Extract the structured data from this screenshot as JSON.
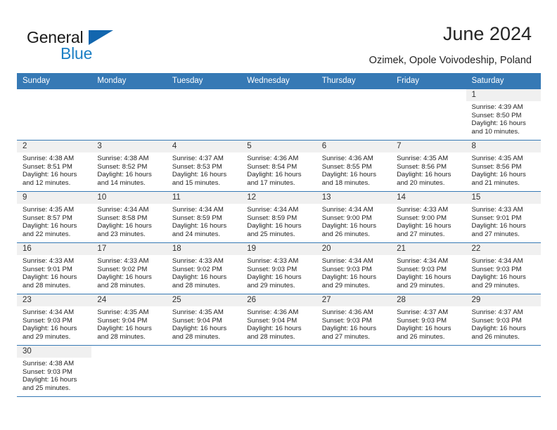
{
  "brand": {
    "name_top": "General",
    "name_bottom": "Blue",
    "sail_icon": "sail-triangle-icon",
    "colors": {
      "black": "#1a1a1a",
      "blue": "#1c7fc4",
      "sail": "#1266ae"
    }
  },
  "header": {
    "title": "June 2024",
    "subtitle": "Ozimek, Opole Voivodeship, Poland"
  },
  "calendar": {
    "header_background": "#3679b5",
    "header_text_color": "#ffffff",
    "daynum_background": "#f0f0f0",
    "weekdays": [
      "Sunday",
      "Monday",
      "Tuesday",
      "Wednesday",
      "Thursday",
      "Friday",
      "Saturday"
    ],
    "labels": {
      "sunrise": "Sunrise:",
      "sunset": "Sunset:",
      "daylight": "Daylight:"
    },
    "weeks": [
      [
        {
          "day": "",
          "blank": true
        },
        {
          "day": "",
          "blank": true
        },
        {
          "day": "",
          "blank": true
        },
        {
          "day": "",
          "blank": true
        },
        {
          "day": "",
          "blank": true
        },
        {
          "day": "",
          "blank": true
        },
        {
          "day": "1",
          "sunrise": "Sunrise: 4:39 AM",
          "sunset": "Sunset: 8:50 PM",
          "daylight_line1": "Daylight: 16 hours",
          "daylight_line2": "and 10 minutes."
        }
      ],
      [
        {
          "day": "2",
          "sunrise": "Sunrise: 4:38 AM",
          "sunset": "Sunset: 8:51 PM",
          "daylight_line1": "Daylight: 16 hours",
          "daylight_line2": "and 12 minutes."
        },
        {
          "day": "3",
          "sunrise": "Sunrise: 4:38 AM",
          "sunset": "Sunset: 8:52 PM",
          "daylight_line1": "Daylight: 16 hours",
          "daylight_line2": "and 14 minutes."
        },
        {
          "day": "4",
          "sunrise": "Sunrise: 4:37 AM",
          "sunset": "Sunset: 8:53 PM",
          "daylight_line1": "Daylight: 16 hours",
          "daylight_line2": "and 15 minutes."
        },
        {
          "day": "5",
          "sunrise": "Sunrise: 4:36 AM",
          "sunset": "Sunset: 8:54 PM",
          "daylight_line1": "Daylight: 16 hours",
          "daylight_line2": "and 17 minutes."
        },
        {
          "day": "6",
          "sunrise": "Sunrise: 4:36 AM",
          "sunset": "Sunset: 8:55 PM",
          "daylight_line1": "Daylight: 16 hours",
          "daylight_line2": "and 18 minutes."
        },
        {
          "day": "7",
          "sunrise": "Sunrise: 4:35 AM",
          "sunset": "Sunset: 8:56 PM",
          "daylight_line1": "Daylight: 16 hours",
          "daylight_line2": "and 20 minutes."
        },
        {
          "day": "8",
          "sunrise": "Sunrise: 4:35 AM",
          "sunset": "Sunset: 8:56 PM",
          "daylight_line1": "Daylight: 16 hours",
          "daylight_line2": "and 21 minutes."
        }
      ],
      [
        {
          "day": "9",
          "sunrise": "Sunrise: 4:35 AM",
          "sunset": "Sunset: 8:57 PM",
          "daylight_line1": "Daylight: 16 hours",
          "daylight_line2": "and 22 minutes."
        },
        {
          "day": "10",
          "sunrise": "Sunrise: 4:34 AM",
          "sunset": "Sunset: 8:58 PM",
          "daylight_line1": "Daylight: 16 hours",
          "daylight_line2": "and 23 minutes."
        },
        {
          "day": "11",
          "sunrise": "Sunrise: 4:34 AM",
          "sunset": "Sunset: 8:59 PM",
          "daylight_line1": "Daylight: 16 hours",
          "daylight_line2": "and 24 minutes."
        },
        {
          "day": "12",
          "sunrise": "Sunrise: 4:34 AM",
          "sunset": "Sunset: 8:59 PM",
          "daylight_line1": "Daylight: 16 hours",
          "daylight_line2": "and 25 minutes."
        },
        {
          "day": "13",
          "sunrise": "Sunrise: 4:34 AM",
          "sunset": "Sunset: 9:00 PM",
          "daylight_line1": "Daylight: 16 hours",
          "daylight_line2": "and 26 minutes."
        },
        {
          "day": "14",
          "sunrise": "Sunrise: 4:33 AM",
          "sunset": "Sunset: 9:00 PM",
          "daylight_line1": "Daylight: 16 hours",
          "daylight_line2": "and 27 minutes."
        },
        {
          "day": "15",
          "sunrise": "Sunrise: 4:33 AM",
          "sunset": "Sunset: 9:01 PM",
          "daylight_line1": "Daylight: 16 hours",
          "daylight_line2": "and 27 minutes."
        }
      ],
      [
        {
          "day": "16",
          "sunrise": "Sunrise: 4:33 AM",
          "sunset": "Sunset: 9:01 PM",
          "daylight_line1": "Daylight: 16 hours",
          "daylight_line2": "and 28 minutes."
        },
        {
          "day": "17",
          "sunrise": "Sunrise: 4:33 AM",
          "sunset": "Sunset: 9:02 PM",
          "daylight_line1": "Daylight: 16 hours",
          "daylight_line2": "and 28 minutes."
        },
        {
          "day": "18",
          "sunrise": "Sunrise: 4:33 AM",
          "sunset": "Sunset: 9:02 PM",
          "daylight_line1": "Daylight: 16 hours",
          "daylight_line2": "and 28 minutes."
        },
        {
          "day": "19",
          "sunrise": "Sunrise: 4:33 AM",
          "sunset": "Sunset: 9:03 PM",
          "daylight_line1": "Daylight: 16 hours",
          "daylight_line2": "and 29 minutes."
        },
        {
          "day": "20",
          "sunrise": "Sunrise: 4:34 AM",
          "sunset": "Sunset: 9:03 PM",
          "daylight_line1": "Daylight: 16 hours",
          "daylight_line2": "and 29 minutes."
        },
        {
          "day": "21",
          "sunrise": "Sunrise: 4:34 AM",
          "sunset": "Sunset: 9:03 PM",
          "daylight_line1": "Daylight: 16 hours",
          "daylight_line2": "and 29 minutes."
        },
        {
          "day": "22",
          "sunrise": "Sunrise: 4:34 AM",
          "sunset": "Sunset: 9:03 PM",
          "daylight_line1": "Daylight: 16 hours",
          "daylight_line2": "and 29 minutes."
        }
      ],
      [
        {
          "day": "23",
          "sunrise": "Sunrise: 4:34 AM",
          "sunset": "Sunset: 9:03 PM",
          "daylight_line1": "Daylight: 16 hours",
          "daylight_line2": "and 29 minutes."
        },
        {
          "day": "24",
          "sunrise": "Sunrise: 4:35 AM",
          "sunset": "Sunset: 9:04 PM",
          "daylight_line1": "Daylight: 16 hours",
          "daylight_line2": "and 28 minutes."
        },
        {
          "day": "25",
          "sunrise": "Sunrise: 4:35 AM",
          "sunset": "Sunset: 9:04 PM",
          "daylight_line1": "Daylight: 16 hours",
          "daylight_line2": "and 28 minutes."
        },
        {
          "day": "26",
          "sunrise": "Sunrise: 4:36 AM",
          "sunset": "Sunset: 9:04 PM",
          "daylight_line1": "Daylight: 16 hours",
          "daylight_line2": "and 28 minutes."
        },
        {
          "day": "27",
          "sunrise": "Sunrise: 4:36 AM",
          "sunset": "Sunset: 9:03 PM",
          "daylight_line1": "Daylight: 16 hours",
          "daylight_line2": "and 27 minutes."
        },
        {
          "day": "28",
          "sunrise": "Sunrise: 4:37 AM",
          "sunset": "Sunset: 9:03 PM",
          "daylight_line1": "Daylight: 16 hours",
          "daylight_line2": "and 26 minutes."
        },
        {
          "day": "29",
          "sunrise": "Sunrise: 4:37 AM",
          "sunset": "Sunset: 9:03 PM",
          "daylight_line1": "Daylight: 16 hours",
          "daylight_line2": "and 26 minutes."
        }
      ],
      [
        {
          "day": "30",
          "sunrise": "Sunrise: 4:38 AM",
          "sunset": "Sunset: 9:03 PM",
          "daylight_line1": "Daylight: 16 hours",
          "daylight_line2": "and 25 minutes."
        },
        {
          "day": "",
          "blank": true
        },
        {
          "day": "",
          "blank": true
        },
        {
          "day": "",
          "blank": true
        },
        {
          "day": "",
          "blank": true
        },
        {
          "day": "",
          "blank": true
        },
        {
          "day": "",
          "blank": true
        }
      ]
    ]
  }
}
